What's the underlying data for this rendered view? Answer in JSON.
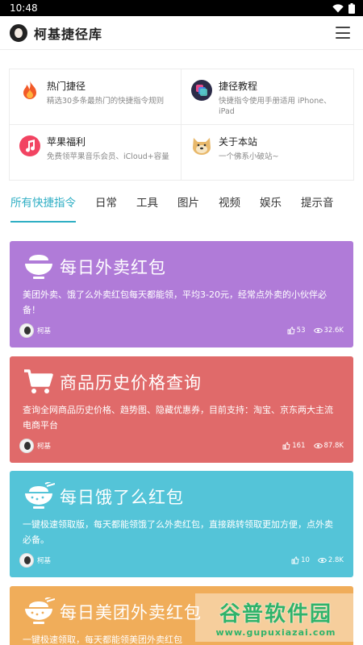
{
  "status": {
    "time": "10:48"
  },
  "header": {
    "title": "柯基捷径库"
  },
  "featured": [
    {
      "title": "热门捷径",
      "desc": "精选30多条最热门的快捷指令规则",
      "icon": "fire-icon"
    },
    {
      "title": "捷径教程",
      "desc": "快捷指令使用手册适用 iPhone、iPad",
      "icon": "shortcuts-icon"
    },
    {
      "title": "苹果福利",
      "desc": "免费领苹果音乐会员、iCloud+容量",
      "icon": "music-icon"
    },
    {
      "title": "关于本站",
      "desc": "一个佛系小破站~",
      "icon": "doge-icon"
    }
  ],
  "tabs": [
    "所有快捷指令",
    "日常",
    "工具",
    "图片",
    "视频",
    "娱乐",
    "提示音"
  ],
  "cards": [
    {
      "title": "每日外卖红包",
      "desc": "美团外卖、饿了么外卖红包每天都能领，平均3-20元，经常点外卖的小伙伴必备！",
      "author": "柯基",
      "likes": "53",
      "views": "32.6K",
      "color": "#b07bd8",
      "icon": "rice-bowl-icon"
    },
    {
      "title": "商品历史价格查询",
      "desc": "查询全网商品历史价格、趋势图、隐藏优惠券，目前支持：淘宝、京东两大主流电商平台",
      "author": "柯基",
      "likes": "161",
      "views": "87.8K",
      "color": "#e06a6a",
      "icon": "cart-icon"
    },
    {
      "title": "每日饿了么红包",
      "desc": "一键极速领取版，每天都能领饿了么外卖红包，直接跳转领取更加方便，点外卖必备。",
      "author": "柯基",
      "likes": "10",
      "views": "2.8K",
      "color": "#54c4d8",
      "icon": "rice-bowl-icon"
    },
    {
      "title": "每日美团外卖红包",
      "desc": "一键极速领取，每天都能领美团外卖红包",
      "author": "",
      "likes": "",
      "views": "",
      "color": "#f0ad5a",
      "icon": "rice-bowl-icon"
    }
  ],
  "watermark": {
    "main": "谷普软件园",
    "url": "www.gupuxiazai.com"
  }
}
